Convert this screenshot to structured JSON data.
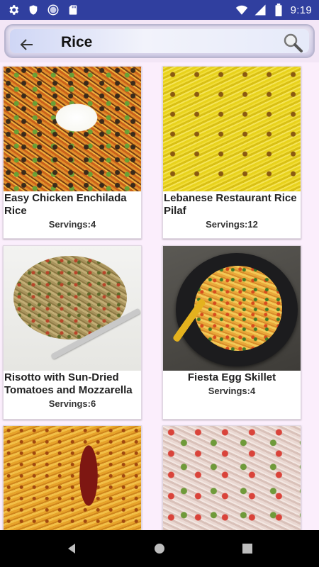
{
  "status_bar": {
    "time": "9:19",
    "left_icons": [
      "gear-icon",
      "shield-icon",
      "circle-icon",
      "sd-card-icon"
    ],
    "right_icons": [
      "wifi-icon",
      "signal-icon",
      "battery-icon"
    ]
  },
  "search": {
    "query": "Rice"
  },
  "recipes": [
    {
      "title": "Easy Chicken Enchilada Rice",
      "servings": "Servings:4"
    },
    {
      "title": "Lebanese Restaurant Rice Pilaf",
      "servings": "Servings:12"
    },
    {
      "title": "Risotto with Sun-Dried Tomatoes and Mozzarella",
      "servings": "Servings:6"
    },
    {
      "title": "Fiesta Egg Skillet",
      "servings": "Servings:4"
    },
    {
      "title": "",
      "servings": ""
    },
    {
      "title": "",
      "servings": ""
    }
  ],
  "nav": {
    "buttons": [
      "back-icon",
      "home-icon",
      "recents-icon"
    ]
  },
  "colors": {
    "status_bar": "#303f9f",
    "background": "#fbeefc",
    "nav_bar": "#000000"
  }
}
